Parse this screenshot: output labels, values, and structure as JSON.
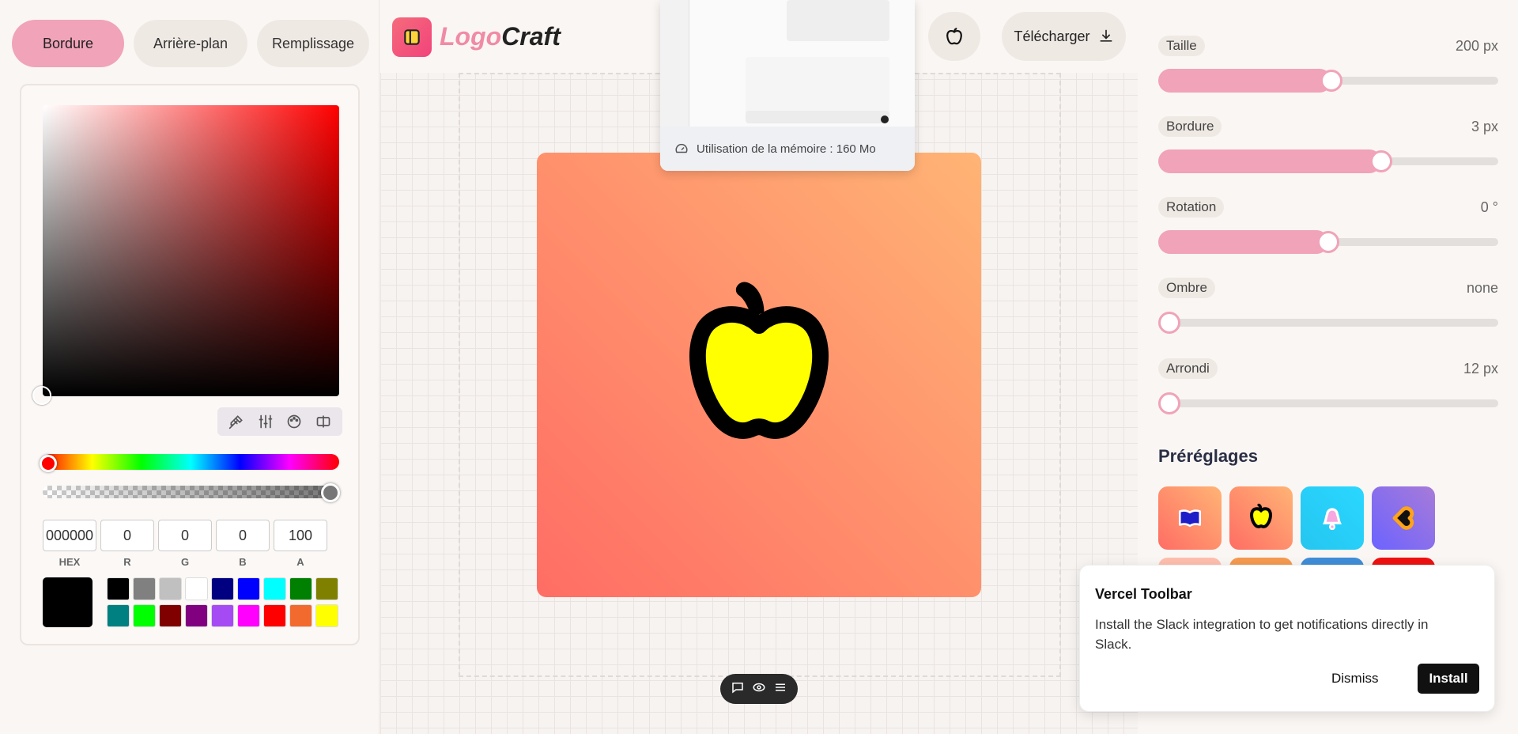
{
  "app": {
    "name_part1": "Logo",
    "name_part2": "Craft"
  },
  "left": {
    "tabs": [
      "Bordure",
      "Arrière-plan",
      "Remplissage"
    ],
    "active_tab": "Bordure",
    "picker": {
      "hex": "000000",
      "r": "0",
      "g": "0",
      "b": "0",
      "a": "100",
      "labels": {
        "hex": "HEX",
        "r": "R",
        "g": "G",
        "b": "B",
        "a": "A"
      },
      "current_color": "#000000",
      "swatches": [
        "#000000",
        "#808080",
        "#c0c0c0",
        "#ffffff",
        "#000080",
        "#0000ff",
        "#00ffff",
        "#008000",
        "#808000",
        "#008080",
        "#00ff00",
        "#800000",
        "#800080",
        "#a64bf4",
        "#ff00ff",
        "#ff0000",
        "#f26a2d",
        "#ffff00"
      ]
    }
  },
  "center": {
    "download_label": "Télécharger",
    "memory_label": "Utilisation de la mémoire : 160 Mo",
    "logo": {
      "background_from": "#ff6d64",
      "background_to": "#ffb475",
      "icon": "apple-icon",
      "fill": "#ffff00",
      "stroke": "#000000"
    }
  },
  "right": {
    "controls": [
      {
        "label": "Taille",
        "value": "200 px",
        "fraction": 0.51
      },
      {
        "label": "Bordure",
        "value": "3 px",
        "fraction": 0.655
      },
      {
        "label": "Rotation",
        "value": "0 °",
        "fraction": 0.5
      },
      {
        "label": "Ombre",
        "value": "none",
        "fraction": 0.0
      },
      {
        "label": "Arrondi",
        "value": "12 px",
        "fraction": 0.0
      }
    ],
    "presets_title": "Préréglages",
    "presets": [
      {
        "icon": "book-icon",
        "bg": "#ff8a6a"
      },
      {
        "icon": "apple-icon",
        "bg": "#ff8a6a"
      },
      {
        "icon": "bell-icon",
        "bg": "#25c6f0"
      },
      {
        "icon": "heart-icon",
        "bg": "#7b6ee0"
      }
    ]
  },
  "toast": {
    "title": "Vercel Toolbar",
    "message": "Install the Slack integration to get notifications directly in Slack.",
    "dismiss": "Dismiss",
    "install": "Install"
  },
  "colors": {
    "accent": "#f0a3b9"
  }
}
